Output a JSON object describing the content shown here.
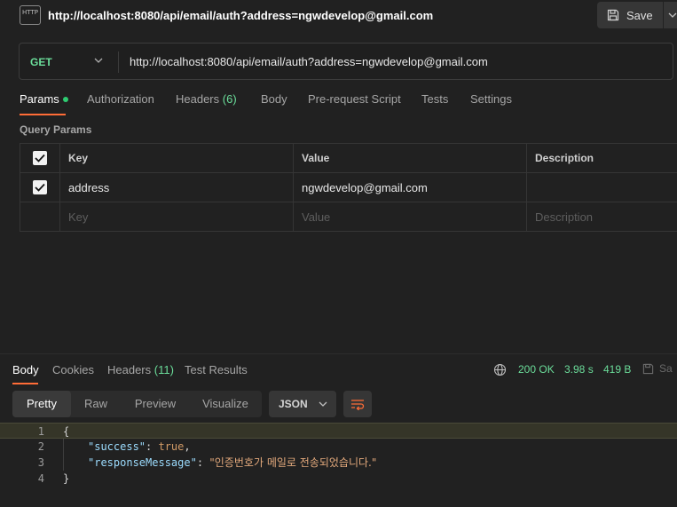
{
  "tab": {
    "badge": "HTTP",
    "title": "http://localhost:8080/api/email/auth?address=ngwdevelop@gmail.com",
    "save_label": "Save"
  },
  "request": {
    "method": "GET",
    "url": "http://localhost:8080/api/email/auth?address=ngwdevelop@gmail.com"
  },
  "request_tabs": {
    "params": "Params",
    "authorization": "Authorization",
    "headers": "Headers",
    "headers_count": "(6)",
    "body": "Body",
    "prerequest": "Pre-request Script",
    "tests": "Tests",
    "settings": "Settings"
  },
  "query_params": {
    "title": "Query Params",
    "columns": {
      "key": "Key",
      "value": "Value",
      "description": "Description"
    },
    "rows": [
      {
        "checked": true,
        "key": "address",
        "value": "ngwdevelop@gmail.com",
        "description": ""
      }
    ],
    "placeholders": {
      "key": "Key",
      "value": "Value",
      "description": "Description"
    }
  },
  "response_tabs": {
    "body": "Body",
    "cookies": "Cookies",
    "headers": "Headers",
    "headers_count": "(11)",
    "test_results": "Test Results"
  },
  "response_status": {
    "status": "200 OK",
    "time": "3.98 s",
    "size": "419 B",
    "save_label": "Sa"
  },
  "format_tabs": {
    "pretty": "Pretty",
    "raw": "Raw",
    "preview": "Preview",
    "visualize": "Visualize"
  },
  "format_select": "JSON",
  "body_lines": [
    {
      "num": "1",
      "brace": "{"
    },
    {
      "num": "2",
      "key": "\"success\"",
      "colon": ": ",
      "value": "true",
      "comma": ","
    },
    {
      "num": "3",
      "key": "\"responseMessage\"",
      "colon": ": ",
      "value": "\"인증번호가 메일로 전송되었습니다.\""
    },
    {
      "num": "4",
      "brace": "}"
    }
  ],
  "colors": {
    "accent": "#ff6c37",
    "green": "#6bdd9a",
    "background": "#212121"
  }
}
